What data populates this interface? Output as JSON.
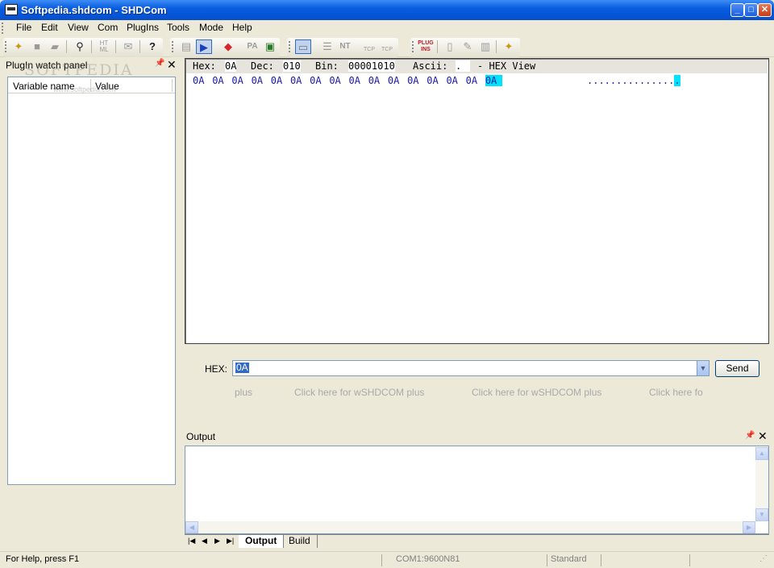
{
  "window": {
    "title": "Softpedia.shdcom - SHDCom",
    "controls": {
      "minimize": "_",
      "maximize": "□",
      "close": "✕"
    }
  },
  "menu": [
    "File",
    "Edit",
    "View",
    "Com",
    "PlugIns",
    "Tools",
    "Mode",
    "Help"
  ],
  "toolbar": {
    "html_label": "HT\nML",
    "pa_label": "PA",
    "nt_label": "NT",
    "plugins_label": "PLUG\nINS",
    "tcp_label": "TCP"
  },
  "plugin_panel": {
    "title": "PlugIn watch panel",
    "columns": [
      "Variable name",
      "Value"
    ],
    "watermark": "SOFTPEDIA",
    "watermark_url": "www.softpedia.com"
  },
  "hex_view": {
    "hex_label": "Hex:",
    "hex_value": "0A",
    "dec_label": "Dec:",
    "dec_value": "010",
    "bin_label": "Bin:",
    "bin_value": "00001010",
    "ascii_label": "Ascii:",
    "ascii_value": ".",
    "mode_label": "- HEX View",
    "bytes": [
      "0A",
      "0A",
      "0A",
      "0A",
      "0A",
      "0A",
      "0A",
      "0A",
      "0A",
      "0A",
      "0A",
      "0A",
      "0A",
      "0A",
      "0A",
      "0A"
    ],
    "selected_byte": "0A",
    "ascii_dots": "...............",
    "ascii_selected": "."
  },
  "send": {
    "label": "HEX:",
    "input_value": "0A",
    "button": "Send",
    "plus_links": [
      "plus",
      "Click here for wSHDCOM plus",
      "Click here for wSHDCOM plus",
      "Click here fo"
    ]
  },
  "output_panel": {
    "title": "Output",
    "tabs": [
      "Output",
      "Build"
    ],
    "active_tab": "Output"
  },
  "statusbar": {
    "help": "For Help, press F1",
    "port": "COM1:9600N81",
    "mode": "Standard"
  }
}
